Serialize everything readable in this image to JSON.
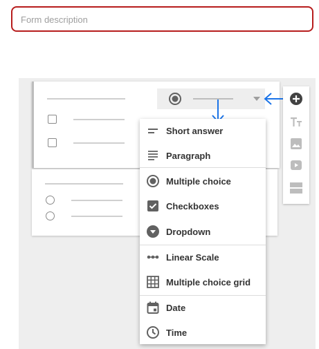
{
  "form": {
    "description_placeholder": "Form description",
    "description_value": ""
  },
  "question_type_menu": {
    "selected": "Multiple choice",
    "groups": [
      [
        {
          "label": "Short answer",
          "icon": "short-answer-icon"
        },
        {
          "label": "Paragraph",
          "icon": "paragraph-icon"
        }
      ],
      [
        {
          "label": "Multiple choice",
          "icon": "radio-button-icon"
        },
        {
          "label": "Checkboxes",
          "icon": "checkbox-icon"
        },
        {
          "label": "Dropdown",
          "icon": "dropdown-icon"
        }
      ],
      [
        {
          "label": "Linear Scale",
          "icon": "linear-scale-icon"
        },
        {
          "label": "Multiple choice grid",
          "icon": "grid-icon"
        }
      ],
      [
        {
          "label": "Date",
          "icon": "calendar-icon"
        },
        {
          "label": "Time",
          "icon": "clock-icon"
        }
      ]
    ]
  },
  "toolbar": {
    "items": [
      "add-question-icon",
      "title-text-icon",
      "image-icon",
      "video-icon",
      "section-icon"
    ]
  },
  "colors": {
    "highlight_border": "#b71c1c",
    "annotation_arrow": "#1a73e8",
    "icon_gray": "#616161"
  }
}
